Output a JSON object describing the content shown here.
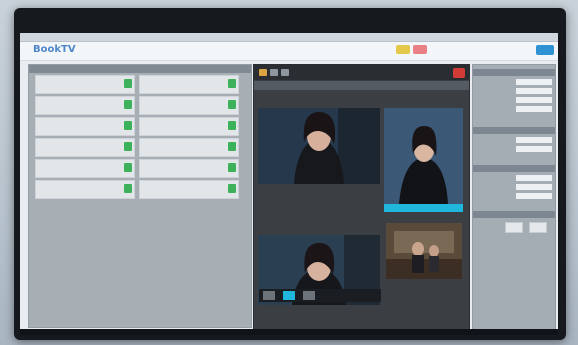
{
  "window": {
    "title": ""
  },
  "header": {
    "logo": "BookTV",
    "logo_sub": "",
    "nav": [
      "",
      ""
    ]
  },
  "guests": [
    {
      "name": "",
      "status": ""
    },
    {
      "name": "",
      "status": ""
    },
    {
      "name": "",
      "status": ""
    },
    {
      "name": "",
      "status": ""
    },
    {
      "name": "",
      "status": ""
    },
    {
      "name": "",
      "status": ""
    },
    {
      "name": "",
      "status": ""
    },
    {
      "name": "",
      "status": ""
    },
    {
      "name": "",
      "status": ""
    },
    {
      "name": "",
      "status": ""
    },
    {
      "name": "",
      "status": ""
    },
    {
      "name": "",
      "status": ""
    }
  ],
  "center": {
    "toolbar_label": "",
    "sub_label": ""
  },
  "right_panel": {
    "sections": [
      "",
      "",
      "",
      ""
    ]
  },
  "colors": {
    "accent": "#2f93d3",
    "record": "#d13c36",
    "check": "#3eb25b",
    "selection": "#1fb7dc"
  },
  "icons": [
    "check-icon",
    "record-icon",
    "camera-icon",
    "settings-icon"
  ]
}
